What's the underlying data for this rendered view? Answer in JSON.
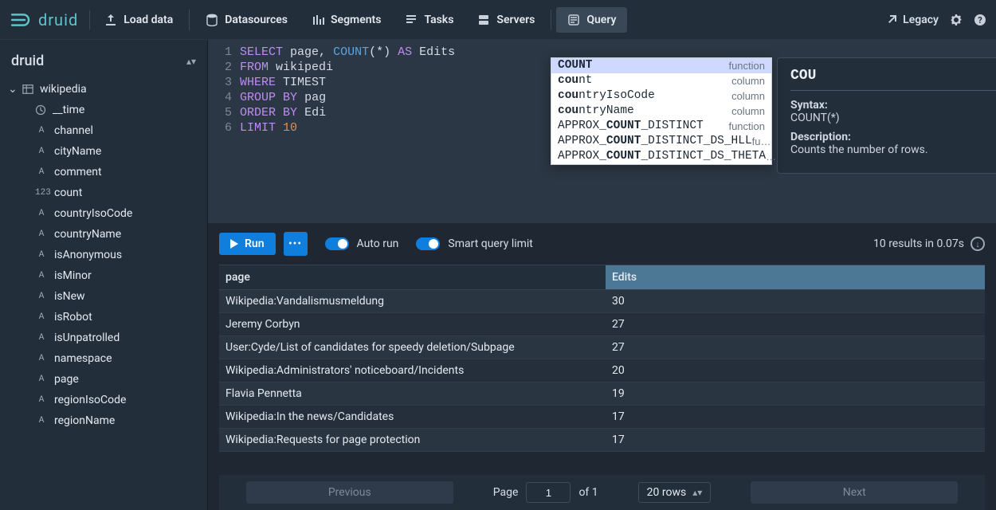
{
  "brand": "druid",
  "nav": {
    "load_data": "Load data",
    "datasources": "Datasources",
    "segments": "Segments",
    "tasks": "Tasks",
    "servers": "Servers",
    "query": "Query",
    "legacy": "Legacy"
  },
  "sidebar": {
    "title": "druid",
    "datasource": "wikipedia",
    "columns": [
      {
        "icon": "time",
        "name": "__time"
      },
      {
        "icon": "A",
        "name": "channel"
      },
      {
        "icon": "A",
        "name": "cityName"
      },
      {
        "icon": "A",
        "name": "comment"
      },
      {
        "icon": "123",
        "name": "count"
      },
      {
        "icon": "A",
        "name": "countryIsoCode"
      },
      {
        "icon": "A",
        "name": "countryName"
      },
      {
        "icon": "A",
        "name": "isAnonymous"
      },
      {
        "icon": "A",
        "name": "isMinor"
      },
      {
        "icon": "A",
        "name": "isNew"
      },
      {
        "icon": "A",
        "name": "isRobot"
      },
      {
        "icon": "A",
        "name": "isUnpatrolled"
      },
      {
        "icon": "A",
        "name": "namespace"
      },
      {
        "icon": "A",
        "name": "page"
      },
      {
        "icon": "A",
        "name": "regionIsoCode"
      },
      {
        "icon": "A",
        "name": "regionName"
      }
    ]
  },
  "sql": {
    "lines": [
      "SELECT page, COUNT(*) AS Edits",
      "FROM wikipedi",
      "WHERE TIMEST",
      "GROUP BY pag",
      "ORDER BY Edi",
      "LIMIT 10"
    ]
  },
  "autocomplete": {
    "items": [
      {
        "label_pre": "",
        "label_bold": "COUNT",
        "label_post": "",
        "kind": "function",
        "selected": true
      },
      {
        "label_pre": "",
        "label_bold": "cou",
        "label_post": "nt",
        "kind": "column"
      },
      {
        "label_pre": "",
        "label_bold": "cou",
        "label_post": "ntryIsoCode",
        "kind": "column"
      },
      {
        "label_pre": "",
        "label_bold": "cou",
        "label_post": "ntryName",
        "kind": "column"
      },
      {
        "label_pre": "APPROX_",
        "label_bold": "COUNT",
        "label_post": "_DISTINCT",
        "kind": "function"
      },
      {
        "label_pre": "APPROX_",
        "label_bold": "COUNT",
        "label_post": "_DISTINCT_DS_HLL",
        "kind": "fu…"
      },
      {
        "label_pre": "APPROX_",
        "label_bold": "COUNT",
        "label_post": "_DISTINCT_DS_THETA",
        "kind": "…"
      }
    ]
  },
  "doc": {
    "title": "COU",
    "syntax_label": "Syntax:",
    "syntax": "COUNT(*)",
    "desc_label": "Description:",
    "desc": "Counts the number of rows."
  },
  "controls": {
    "run": "Run",
    "auto_run": "Auto run",
    "smart_limit": "Smart query limit",
    "result_info": "10 results in 0.07s"
  },
  "results": {
    "columns": {
      "page": "page",
      "edits": "Edits"
    },
    "rows": [
      {
        "page": "Wikipedia:Vandalismusmeldung",
        "edits": "30"
      },
      {
        "page": "Jeremy Corbyn",
        "edits": "27"
      },
      {
        "page": "User:Cyde/List of candidates for speedy deletion/Subpage",
        "edits": "27"
      },
      {
        "page": "Wikipedia:Administrators' noticeboard/Incidents",
        "edits": "20"
      },
      {
        "page": "Flavia Pennetta",
        "edits": "19"
      },
      {
        "page": "Wikipedia:In the news/Candidates",
        "edits": "17"
      },
      {
        "page": "Wikipedia:Requests for page protection",
        "edits": "17"
      }
    ]
  },
  "pager": {
    "prev": "Previous",
    "next": "Next",
    "page_label": "Page",
    "page": "1",
    "of_label": "of 1",
    "rows": "20 rows"
  }
}
